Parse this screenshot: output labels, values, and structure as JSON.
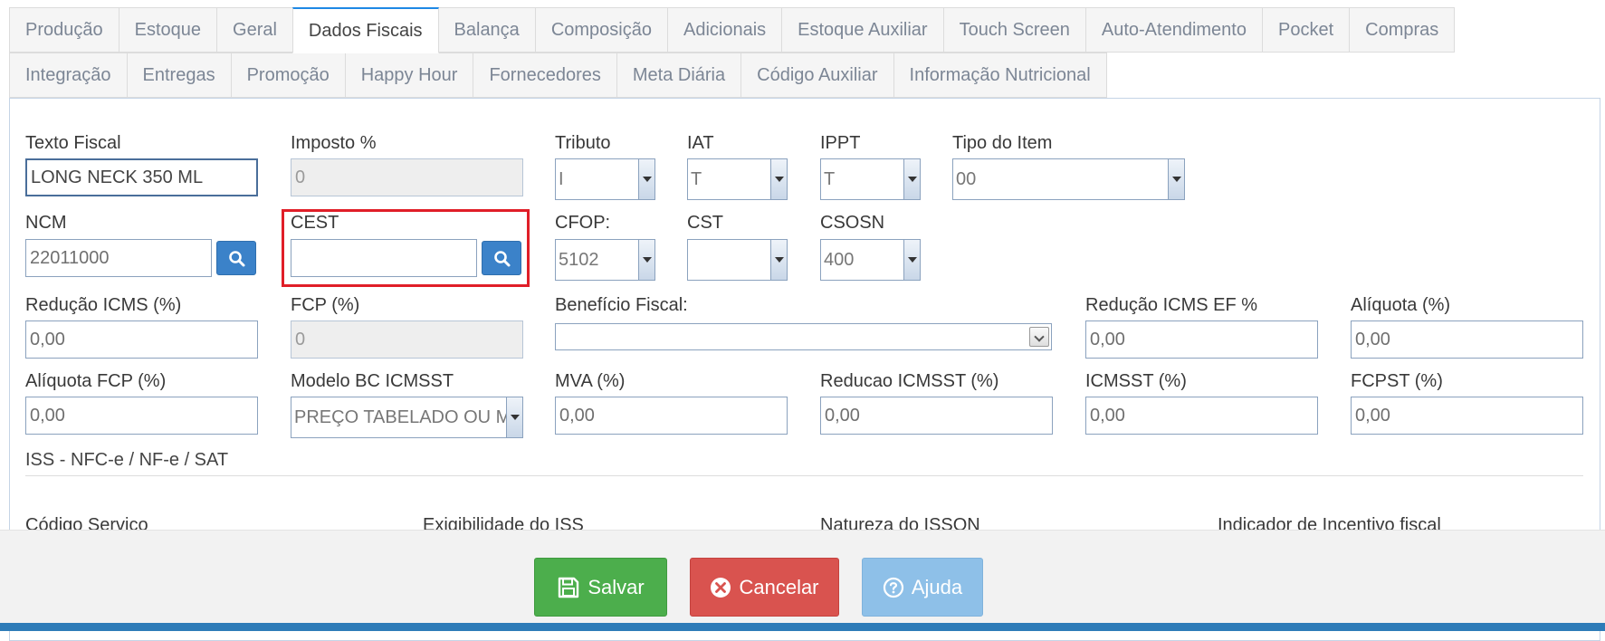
{
  "tabs": {
    "row1": [
      "Produção",
      "Estoque",
      "Geral",
      "Dados Fiscais",
      "Balança",
      "Composição",
      "Adicionais",
      "Estoque Auxiliar",
      "Touch Screen",
      "Auto-Atendimento",
      "Pocket",
      "Compras"
    ],
    "row2": [
      "Integração",
      "Entregas",
      "Promoção",
      "Happy Hour",
      "Fornecedores",
      "Meta Diária",
      "Código Auxiliar",
      "Informação Nutricional"
    ],
    "active": "Dados Fiscais"
  },
  "fields": {
    "texto_fiscal": {
      "label": "Texto Fiscal",
      "value": "LONG NECK 350 ML"
    },
    "imposto": {
      "label": "Imposto %",
      "value": "0"
    },
    "tributo": {
      "label": "Tributo",
      "value": "I"
    },
    "iat": {
      "label": "IAT",
      "value": "T"
    },
    "ippt": {
      "label": "IPPT",
      "value": "T"
    },
    "tipo_item": {
      "label": "Tipo do Item",
      "value": "00"
    },
    "ncm": {
      "label": "NCM",
      "value": "22011000"
    },
    "cest": {
      "label": "CEST",
      "value": ""
    },
    "cfop": {
      "label": "CFOP:",
      "value": "5102"
    },
    "cst": {
      "label": "CST",
      "value": ""
    },
    "csosn": {
      "label": "CSOSN",
      "value": "400"
    },
    "reducao_icms": {
      "label": "Redução ICMS (%)",
      "value": "0,00"
    },
    "fcp": {
      "label": "FCP (%)",
      "value": "0"
    },
    "beneficio_fiscal": {
      "label": "Benefício Fiscal:",
      "value": ""
    },
    "reducao_icms_ef": {
      "label": "Redução ICMS EF %",
      "value": "0,00"
    },
    "aliquota": {
      "label": "Alíquota (%)",
      "value": "0,00"
    },
    "aliquota_fcp": {
      "label": "Alíquota FCP (%)",
      "value": "0,00"
    },
    "modelo_bc_icmsst": {
      "label": "Modelo BC ICMSST",
      "value": "PREÇO TABELADO OU M"
    },
    "mva": {
      "label": "MVA (%)",
      "value": "0,00"
    },
    "reducao_icmsst": {
      "label": "Reducao ICMSST (%)",
      "value": "0,00"
    },
    "icmsst": {
      "label": "ICMSST (%)",
      "value": "0,00"
    },
    "fcpst": {
      "label": "FCPST (%)",
      "value": "0,00"
    }
  },
  "iss_section": {
    "title": "ISS - NFC-e / NF-e / SAT",
    "labels": [
      "Código Servico",
      "Exigibilidade do ISS",
      "Natureza do ISSQN",
      "Indicador de Incentivo fiscal"
    ]
  },
  "buttons": {
    "save": "Salvar",
    "cancel": "Cancelar",
    "help": "Ajuda"
  },
  "icons": {
    "search": "search-icon",
    "save": "floppy-disk-icon",
    "cancel": "close-circle-icon",
    "help": "question-circle-icon"
  },
  "colors": {
    "save": "#4cae4c",
    "cancel": "#d9534f",
    "help": "#8ec0e8",
    "highlight": "#e01e28",
    "search_button": "#3b82c9"
  }
}
